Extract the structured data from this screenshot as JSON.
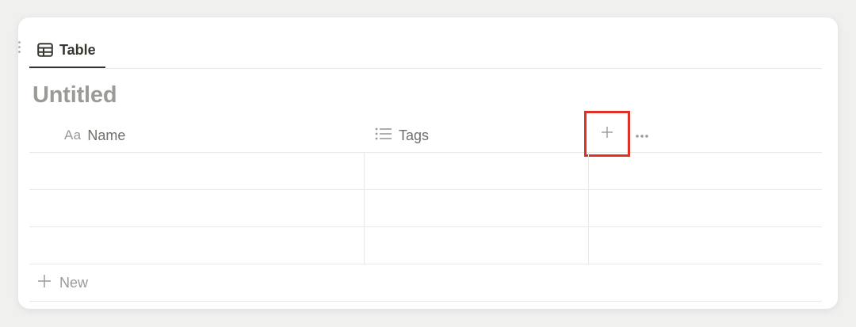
{
  "tab": {
    "label": "Table",
    "icon": "table-icon"
  },
  "database": {
    "title": "Untitled"
  },
  "columns": {
    "name": {
      "type_icon": "Aa",
      "label": "Name"
    },
    "tags": {
      "type_icon": "list-icon",
      "label": "Tags"
    },
    "add": {
      "icon": "plus-icon",
      "highlight_color": "#e03224"
    },
    "more": {
      "icon": "more-horizontal-icon"
    }
  },
  "rows": [
    {
      "name": "",
      "tags": ""
    },
    {
      "name": "",
      "tags": ""
    },
    {
      "name": "",
      "tags": ""
    }
  ],
  "new_row": {
    "label": "New",
    "icon": "plus-icon"
  },
  "colors": {
    "text_primary": "#37352f",
    "text_muted": "#9b9a97",
    "divider": "#e9e9e7",
    "highlight": "#e03224"
  }
}
